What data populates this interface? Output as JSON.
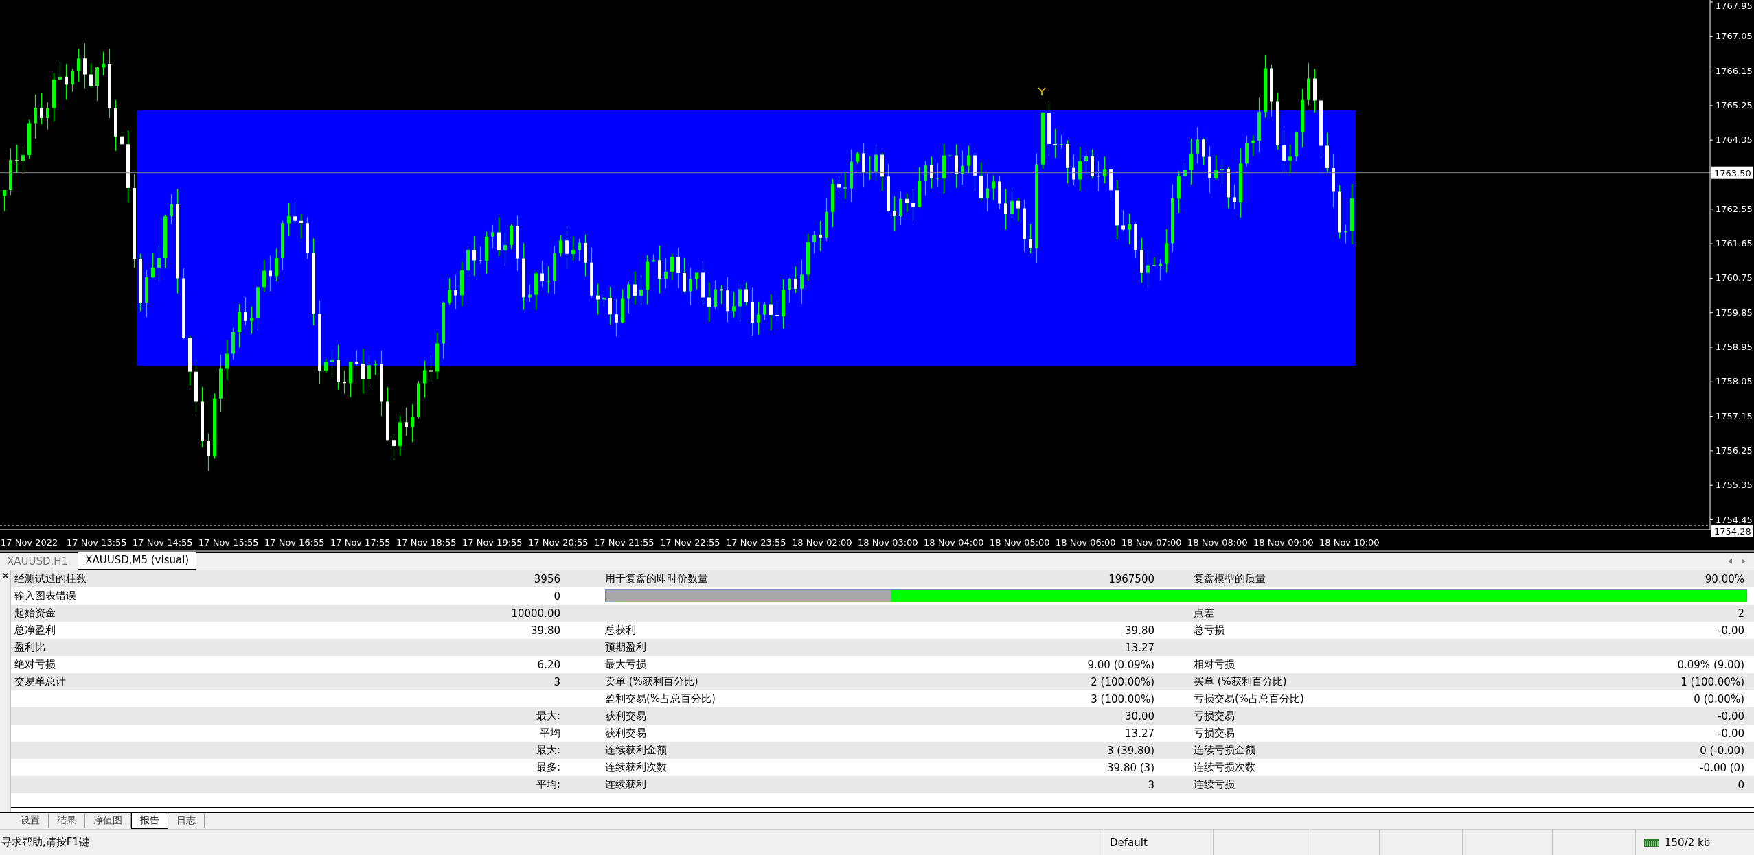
{
  "chart": {
    "price_labels": [
      "1767.95",
      "1767.05",
      "1766.15",
      "1765.25",
      "1764.35",
      "1762.55",
      "1761.65",
      "1760.75",
      "1759.85",
      "1758.95",
      "1758.05",
      "1757.15",
      "1756.25",
      "1755.35",
      "1754.45"
    ],
    "current_price": "1763.50",
    "bottom_price": "1754.28",
    "time_labels": [
      "17 Nov 2022",
      "17 Nov 13:55",
      "17 Nov 14:55",
      "17 Nov 15:55",
      "17 Nov 16:55",
      "17 Nov 17:55",
      "17 Nov 18:55",
      "17 Nov 19:55",
      "17 Nov 20:55",
      "17 Nov 21:55",
      "17 Nov 22:55",
      "17 Nov 23:55",
      "18 Nov 02:00",
      "18 Nov 03:00",
      "18 Nov 04:00",
      "18 Nov 05:00",
      "18 Nov 06:00",
      "18 Nov 07:00",
      "18 Nov 08:00",
      "18 Nov 09:00",
      "18 Nov 10:00"
    ]
  },
  "chart_tabs": [
    {
      "label": "XAUUSD,H1",
      "selected": false
    },
    {
      "label": "XAUUSD,M5 (visual)",
      "selected": true
    }
  ],
  "report": {
    "rows": [
      {
        "kind": "text",
        "label_1": "经测试过的柱数",
        "value_1": "3956",
        "label_2": "用于复盘的即时价数量",
        "value_2": "1967500",
        "label_3": "复盘模型的质量",
        "value_3": "90.00%"
      },
      {
        "kind": "progress",
        "label_1": "输入图表错误",
        "value_1": "0",
        "level": 0.75
      },
      {
        "kind": "text",
        "label_1": "起始资金",
        "value_1": "10000.00",
        "label_3": "点差",
        "value_3": "2"
      },
      {
        "kind": "text",
        "label_1": "总净盈利",
        "value_1": "39.80",
        "label_2": "总获利",
        "value_2": "39.80",
        "label_3": "总亏损",
        "value_3": "-0.00"
      },
      {
        "kind": "text",
        "label_1": "盈利比",
        "label_2": "预期盈利",
        "value_2": "13.27"
      },
      {
        "kind": "text",
        "label_1": "绝对亏损",
        "value_1": "6.20",
        "label_2": "最大亏损",
        "value_2": "9.00 (0.09%)",
        "label_3": "相对亏损",
        "value_3": "0.09% (9.00)"
      },
      {
        "kind": "text",
        "label_1": "交易单总计",
        "value_1": "3",
        "label_2": "卖单 (%获利百分比)",
        "value_2": "2 (100.00%)",
        "label_3": "买单 (%获利百分比)",
        "value_3": "1 (100.00%)"
      },
      {
        "kind": "text",
        "label_2": "盈利交易(%占总百分比)",
        "value_2": "3 (100.00%)",
        "label_3": "亏损交易(%占总百分比)",
        "value_3": "0 (0.00%)"
      },
      {
        "kind": "text",
        "value_1": "最大:",
        "label_2": "获利交易",
        "value_2": "30.00",
        "label_3": "亏损交易",
        "value_3": "-0.00"
      },
      {
        "kind": "text",
        "value_1": "平均",
        "label_2": "获利交易",
        "value_2": "13.27",
        "label_3": "亏损交易",
        "value_3": "-0.00"
      },
      {
        "kind": "text",
        "value_1": "最大:",
        "label_2": "连续获利金额",
        "value_2": "3 (39.80)",
        "label_3": "连续亏损金额",
        "value_3": "0 (-0.00)"
      },
      {
        "kind": "text",
        "value_1": "最多:",
        "label_2": "连续获利次数",
        "value_2": "39.80 (3)",
        "label_3": "连续亏损次数",
        "value_3": "-0.00 (0)"
      },
      {
        "kind": "text",
        "value_1": "平均:",
        "label_2": "连续获利",
        "value_2": "3",
        "label_3": "连续亏损",
        "value_3": "0"
      }
    ]
  },
  "tester_tabs": [
    {
      "label": "设置",
      "selected": false
    },
    {
      "label": "结果",
      "selected": false
    },
    {
      "label": "净值图",
      "selected": false
    },
    {
      "label": "报告",
      "selected": true
    },
    {
      "label": "日志",
      "selected": false
    }
  ],
  "status_bar": {
    "help": "寻求帮助,请按F1键",
    "profile": "Default",
    "traffic": "150/2 kb"
  }
}
